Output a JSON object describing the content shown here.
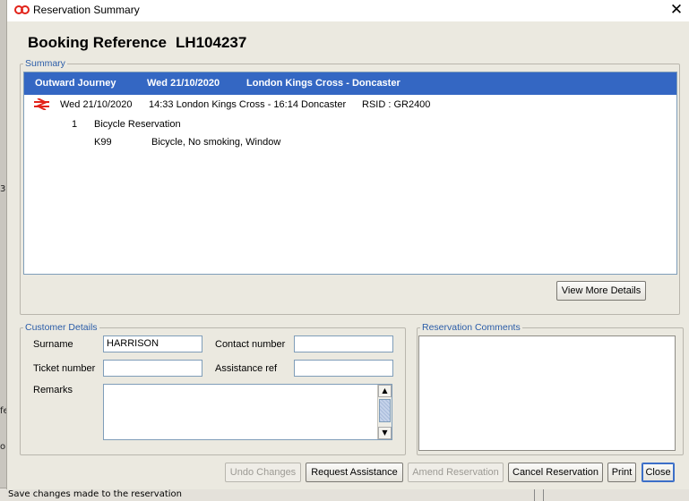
{
  "window": {
    "title": "Reservation Summary",
    "close_glyph": "✕"
  },
  "booking": {
    "label": "Booking Reference",
    "value": "LH104237"
  },
  "summary": {
    "legend": "Summary",
    "header": {
      "journey": "Outward Journey",
      "date": "Wed 21/10/2020",
      "route": "London Kings Cross - Doncaster"
    },
    "service": {
      "icon": "national-rail-icon",
      "date": "Wed 21/10/2020",
      "details": "14:33 London Kings Cross - 16:14 Doncaster",
      "rsid": "RSID : GR2400"
    },
    "reservation": {
      "count": "1",
      "type": "Bicycle Reservation"
    },
    "seat": {
      "code": "K99",
      "attributes": "Bicycle, No smoking, Window"
    },
    "view_more_label": "View More Details"
  },
  "customer": {
    "legend": "Customer Details",
    "surname_label": "Surname",
    "surname_value": "HARRISON",
    "contact_label": "Contact number",
    "contact_value": "",
    "ticket_label": "Ticket number",
    "ticket_value": "",
    "assistance_label": "Assistance ref",
    "assistance_value": "",
    "remarks_label": "Remarks",
    "remarks_value": ""
  },
  "comments": {
    "legend": "Reservation Comments",
    "value": ""
  },
  "actions": {
    "undo": "Undo Changes",
    "request_assistance": "Request Assistance",
    "amend": "Amend Reservation",
    "cancel": "Cancel Reservation",
    "print": "Print",
    "close": "Close"
  },
  "status_bar": {
    "text": "Save changes made to the reservation"
  },
  "background_fragments": [
    "3",
    "fe",
    "o"
  ],
  "colors": {
    "header_blue": "#3467c3",
    "legend_blue": "#2a5ca8",
    "rail_red": "#e2231a"
  }
}
